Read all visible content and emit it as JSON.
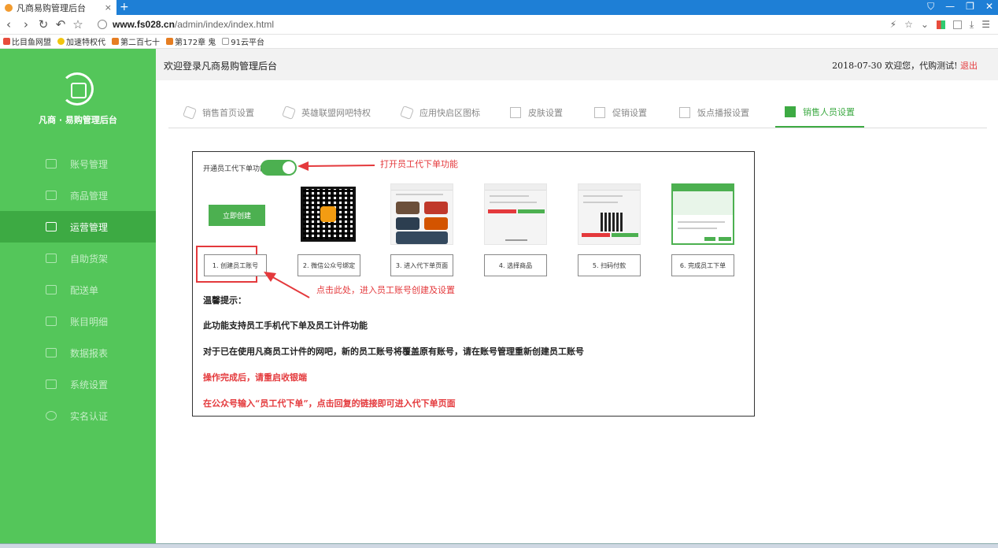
{
  "browser": {
    "tab_title": "凡商易购管理后台",
    "tab_close": "×",
    "new_tab": "+",
    "url_domain": "www.fs028.cn",
    "url_path": "/admin/index/index.html",
    "bookmarks": [
      "比目鱼网盟",
      "加速特权代",
      "第二百七十",
      "第172章 鬼",
      "91云平台"
    ]
  },
  "sidebar": {
    "brand": "凡商 · 易购管理后台",
    "items": [
      {
        "label": "账号管理"
      },
      {
        "label": "商品管理"
      },
      {
        "label": "运营管理"
      },
      {
        "label": "自助货架"
      },
      {
        "label": "配送单"
      },
      {
        "label": "账目明细"
      },
      {
        "label": "数据报表"
      },
      {
        "label": "系统设置"
      },
      {
        "label": "实名认证"
      }
    ]
  },
  "header": {
    "welcome": "欢迎登录凡商易购管理后台",
    "date": "2018-07-30",
    "greeting": "欢迎您，代购测试!",
    "logout": "退出"
  },
  "tabs": [
    {
      "label": "销售首页设置"
    },
    {
      "label": "英雄联盟网吧特权"
    },
    {
      "label": "应用快启区图标"
    },
    {
      "label": "皮肤设置"
    },
    {
      "label": "促销设置"
    },
    {
      "label": "饭点播报设置"
    },
    {
      "label": "销售人员设置"
    }
  ],
  "panel": {
    "toggle_label": "开通员工代下单功能",
    "toggle_on": true,
    "create_button": "立即创建",
    "steps": [
      "1. 创建员工账号",
      "2. 微信公众号绑定",
      "3. 进入代下单页面",
      "4. 选择商品",
      "5. 扫码付款",
      "6. 完成员工下单"
    ],
    "tip_title": "温馨提示：",
    "tips": [
      "此功能支持员工手机代下单及员工计件功能",
      "对于已在使用凡商员工计件的网吧，新的员工账号将覆盖原有账号，请在账号管理重新创建员工账号"
    ],
    "red_tips": [
      "操作完成后，请重启收银端",
      "在公众号输入“员工代下单”，点击回复的链接即可进入代下单页面"
    ]
  },
  "annotations": {
    "toggle_hint": "打开员工代下单功能",
    "create_hint": "点击此处，进入员工账号创建及设置"
  },
  "colors": {
    "sidebar_bg": "#54c65a",
    "active_green": "#3daa43",
    "accent_red": "#e4393c",
    "tabbar_blue": "#1e7fd6"
  }
}
